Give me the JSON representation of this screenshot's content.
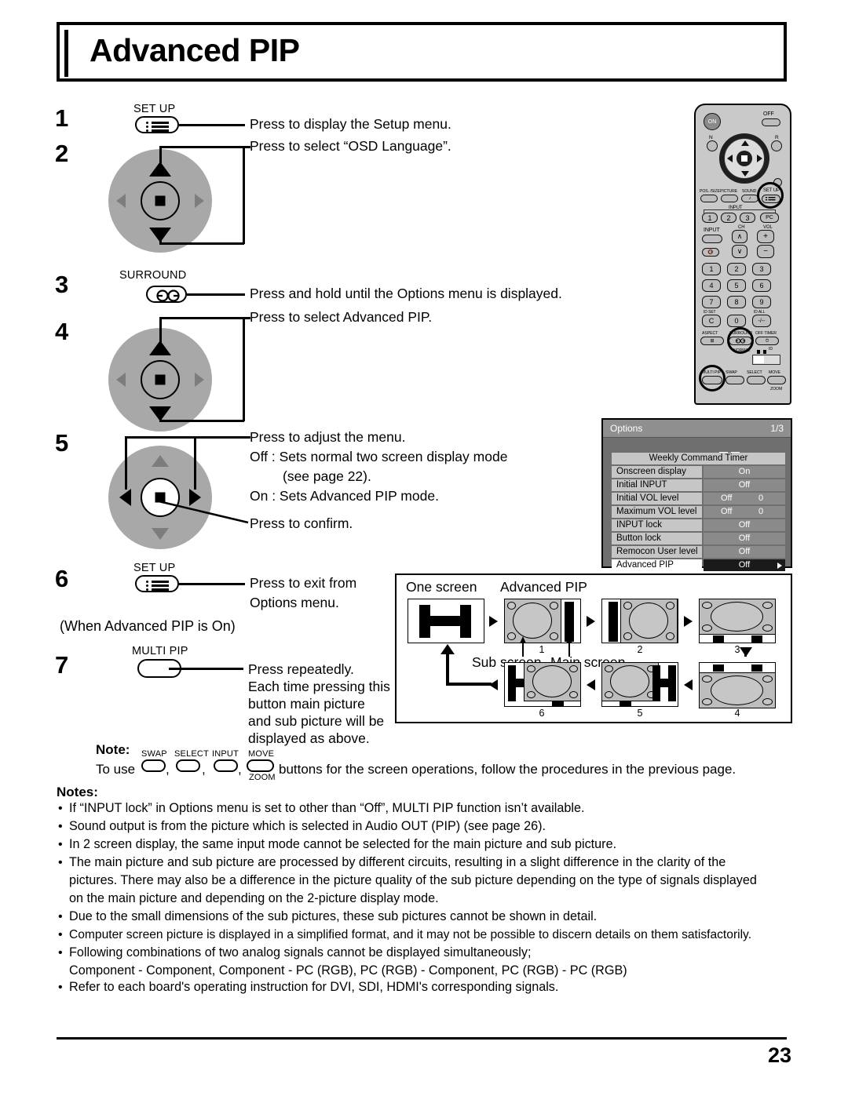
{
  "document": {
    "title": "Advanced PIP",
    "page_number": "23"
  },
  "steps": [
    {
      "num": "1",
      "button_label": "SET UP",
      "button_icon": "setup-menu-icon",
      "desc": [
        "Press to display the Setup menu."
      ]
    },
    {
      "num": "2",
      "button_label": "",
      "button_icon": "dpad-up-down-icon",
      "desc": [
        "Press to select “OSD Language”."
      ]
    },
    {
      "num": "3",
      "button_label": "SURROUND",
      "button_icon": "surround-icon",
      "desc": [
        "Press and hold until the Options menu is displayed."
      ]
    },
    {
      "num": "4",
      "button_label": "",
      "button_icon": "dpad-up-down-icon",
      "desc": [
        "Press to select Advanced PIP."
      ]
    },
    {
      "num": "5",
      "button_label": "",
      "button_icon": "dpad-left-right-enter-icon",
      "desc": [
        "Press to adjust the menu.",
        "Off : Sets normal two screen display mode",
        "(see page 22).",
        "On : Sets Advanced PIP mode.",
        "Press to confirm."
      ]
    },
    {
      "num": "6",
      "button_label": "SET UP",
      "button_icon": "setup-menu-icon",
      "desc": [
        "Press to exit from",
        "Options menu."
      ]
    },
    {
      "num": "7",
      "button_label": "MULTI PIP",
      "button_icon": "multi-pip-icon",
      "desc": [
        "Press repeatedly.",
        "Each time pressing this",
        "button  main  picture",
        "and sub picture will be",
        "displayed as above."
      ]
    }
  ],
  "condition_line": "(When Advanced PIP is On)",
  "note": {
    "heading": "Note:",
    "prefix": "To use",
    "buttons": [
      "SWAP",
      "SELECT",
      "INPUT",
      "MOVE"
    ],
    "move_sub": "ZOOM",
    "suffix": "buttons for the screen operations, follow the procedures in the previous page."
  },
  "notes": {
    "heading": "Notes:",
    "items": [
      [
        "If “INPUT lock” in Options menu is set to other than “Off”, MULTI PIP function isn’t available."
      ],
      [
        "Sound output is from the picture which is selected in Audio OUT (PIP) (see page 26)."
      ],
      [
        "In 2 screen display, the same input mode cannot be selected for the main picture and sub picture."
      ],
      [
        "The main picture and sub picture are processed by different circuits, resulting in a slight difference in the clarity of the",
        "pictures. There may also be a difference in the picture quality of the sub picture depending on the type of signals displayed",
        "on the main picture and depending on the 2-picture display mode."
      ],
      [
        "Due to the small dimensions of the sub pictures, these sub pictures cannot be shown in detail."
      ],
      [
        "Computer screen picture is displayed in a simplified format, and it may not be possible to discern details on them satisfactorily."
      ],
      [
        "Following combinations of two analog signals cannot be displayed simultaneously;",
        "Component - Component, Component - PC (RGB), PC (RGB) - Component, PC (RGB) - PC (RGB)"
      ],
      [
        "Refer to each board's operating instruction for DVI, SDI, HDMI's corresponding signals."
      ]
    ]
  },
  "osd": {
    "title": "Options",
    "page_indicator": "1/3",
    "rows": [
      {
        "label": "Weekly Command Timer",
        "value": "",
        "value2": "",
        "full": true,
        "selected": false
      },
      {
        "label": "Onscreen display",
        "value": "On",
        "value2": "",
        "full": false,
        "selected": false
      },
      {
        "label": "Initial INPUT",
        "value": "Off",
        "value2": "",
        "full": false,
        "selected": false
      },
      {
        "label": "Initial VOL level",
        "value": "Off",
        "value2": "0",
        "full": false,
        "selected": false
      },
      {
        "label": "Maximum VOL level",
        "value": "Off",
        "value2": "0",
        "full": false,
        "selected": false
      },
      {
        "label": "INPUT lock",
        "value": "Off",
        "value2": "",
        "full": false,
        "selected": false
      },
      {
        "label": "Button lock",
        "value": "Off",
        "value2": "",
        "full": false,
        "selected": false
      },
      {
        "label": "Remocon User level",
        "value": "Off",
        "value2": "",
        "full": false,
        "selected": false
      },
      {
        "label": "Advanced PIP",
        "value": "Off",
        "value2": "",
        "full": false,
        "selected": true
      }
    ]
  },
  "pip_diagram": {
    "label_one_screen": "One screen",
    "label_advanced_pip": "Advanced PIP",
    "label_sub_screen": "Sub screen",
    "label_main_screen": "Main screen",
    "screen_numbers": [
      "1",
      "2",
      "3",
      "4",
      "5",
      "6"
    ]
  },
  "remote": {
    "power_on": "ON",
    "power_off": "OFF",
    "n_label": "N",
    "r_label": "R",
    "row_labels": [
      "POS. /SIZE",
      "PICTURE",
      "SOUND",
      "SET UP"
    ],
    "input_label": "INPUT",
    "input_numbers": [
      "1",
      "2",
      "3",
      "PC"
    ],
    "input_button": "INPUT",
    "ch_label": "CH",
    "vol_label": "VOL",
    "keypad": [
      "1",
      "2",
      "3",
      "4",
      "5",
      "6",
      "7",
      "8",
      "9",
      "C",
      "0",
      "-/--"
    ],
    "id_set": "ID SET",
    "id_all": "ID ALL",
    "aspect": "ASPECT",
    "surround": "SURROUND",
    "off_timer": "OFF TIMER",
    "normal": "NORMAL",
    "id": "ID",
    "multi_pip": "MULTI PIP",
    "swap": "SWAP",
    "select": "SELECT",
    "move": "MOVE",
    "zoom": "ZOOM"
  },
  "colors": {
    "ink": "#000000",
    "dpad_gray": "#a8a8a8",
    "osd_bg": "#6f6f6f",
    "osd_label": "#c6c6c6",
    "remote_body": "#c9c9c9"
  }
}
